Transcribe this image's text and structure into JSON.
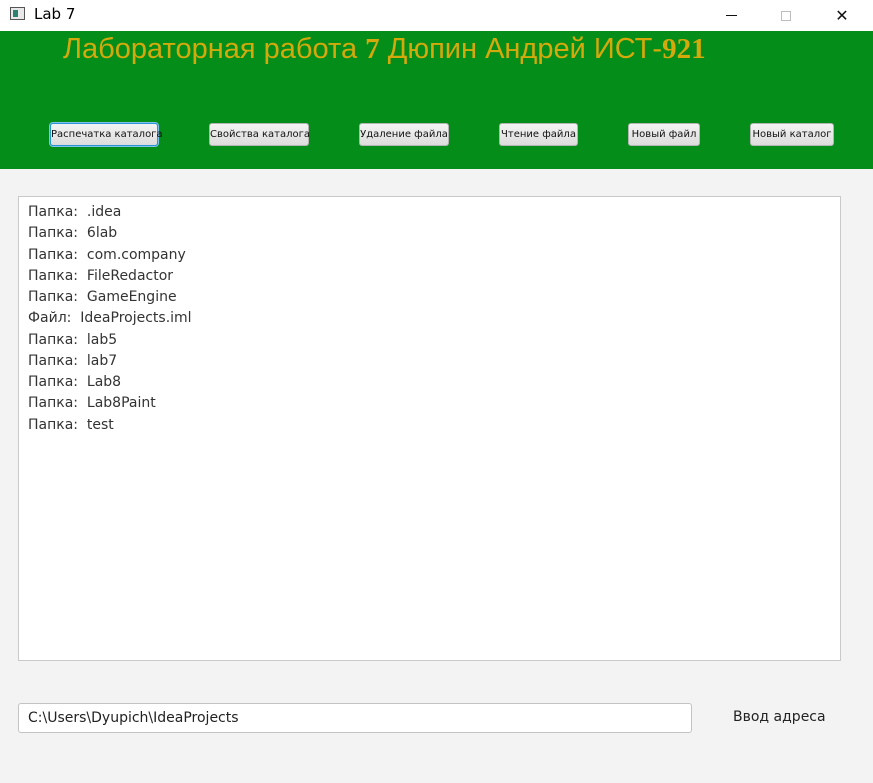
{
  "window": {
    "title": "Lab 7",
    "close_glyph": "✕"
  },
  "header": {
    "title_part1": "Лабораторная работа ",
    "title_num1": "7",
    "title_part2": " Дюпин Андрей ИСТ-",
    "title_num2": "921",
    "background": "#058d1a",
    "title_color": "#d4a90c"
  },
  "toolbar": {
    "buttons": [
      "Распечатка каталога",
      "Свойства каталога",
      "Удаление файла",
      "Чтение файла",
      "Новый файл",
      "Новый каталог"
    ]
  },
  "listing": {
    "items": [
      "Папка:  .idea",
      "Папка:  6lab",
      "Папка:  com.company",
      "Папка:  FileRedactor",
      "Папка:  GameEngine",
      "Файл:  IdeaProjects.iml",
      "Папка:  lab5",
      "Папка:  lab7",
      "Папка:  Lab8",
      "Папка:  Lab8Paint",
      "Папка:  test"
    ]
  },
  "address": {
    "value": "C:\\Users\\Dyupich\\IdeaProjects",
    "label": "Ввод адреса"
  }
}
